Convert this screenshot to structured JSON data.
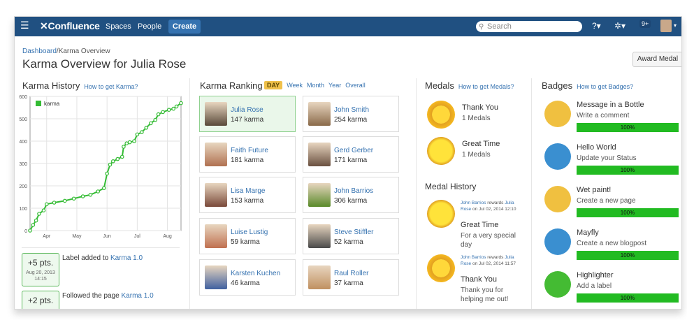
{
  "topbar": {
    "logo": "Confluence",
    "spaces": "Spaces",
    "people": "People",
    "create": "Create",
    "search_placeholder": "Search",
    "notif_count": "9+"
  },
  "breadcrumb": {
    "root": "Dashboard",
    "current": "/Karma Overview"
  },
  "page_title": "Karma Overview for Julia Rose",
  "award_button": "Award Medal",
  "karma_history": {
    "heading": "Karma History",
    "help": "How to get Karma?",
    "chart_data": {
      "type": "line",
      "title": "",
      "series": [
        {
          "name": "karma",
          "values": [
            {
              "x": 0.0,
              "y": 0
            },
            {
              "x": 0.02,
              "y": 25
            },
            {
              "x": 0.04,
              "y": 45
            },
            {
              "x": 0.06,
              "y": 75
            },
            {
              "x": 0.09,
              "y": 90
            },
            {
              "x": 0.11,
              "y": 118
            },
            {
              "x": 0.16,
              "y": 125
            },
            {
              "x": 0.23,
              "y": 133
            },
            {
              "x": 0.29,
              "y": 143
            },
            {
              "x": 0.35,
              "y": 153
            },
            {
              "x": 0.4,
              "y": 160
            },
            {
              "x": 0.45,
              "y": 175
            },
            {
              "x": 0.49,
              "y": 190
            },
            {
              "x": 0.51,
              "y": 255
            },
            {
              "x": 0.53,
              "y": 295
            },
            {
              "x": 0.55,
              "y": 310
            },
            {
              "x": 0.58,
              "y": 320
            },
            {
              "x": 0.61,
              "y": 330
            },
            {
              "x": 0.62,
              "y": 375
            },
            {
              "x": 0.64,
              "y": 390
            },
            {
              "x": 0.66,
              "y": 395
            },
            {
              "x": 0.69,
              "y": 400
            },
            {
              "x": 0.71,
              "y": 430
            },
            {
              "x": 0.74,
              "y": 440
            },
            {
              "x": 0.77,
              "y": 460
            },
            {
              "x": 0.8,
              "y": 480
            },
            {
              "x": 0.83,
              "y": 495
            },
            {
              "x": 0.85,
              "y": 520
            },
            {
              "x": 0.88,
              "y": 530
            },
            {
              "x": 0.92,
              "y": 540
            },
            {
              "x": 0.95,
              "y": 545
            },
            {
              "x": 0.97,
              "y": 555
            },
            {
              "x": 1.0,
              "y": 570
            }
          ]
        }
      ],
      "x_ticks": [
        "Apr",
        "May",
        "Jun",
        "Jul",
        "Aug"
      ],
      "y_ticks": [
        0,
        100,
        200,
        300,
        400,
        500,
        600
      ],
      "ylim": [
        0,
        600
      ],
      "xlim": [
        0,
        1
      ],
      "grid": true,
      "legend": "top-left",
      "colors": {
        "line": "#33bb33"
      }
    }
  },
  "activities": [
    {
      "pts": "+5 pts.",
      "date": "Aug 20, 2013 14:15",
      "text": "Label added to",
      "link": "Karma 1.0"
    },
    {
      "pts": "+2 pts.",
      "date": "",
      "text": "Followed the page",
      "link": "Karma 1.0"
    }
  ],
  "ranking": {
    "heading": "Karma Ranking",
    "tabs": [
      "DAY",
      "Week",
      "Month",
      "Year",
      "Overall"
    ],
    "people": [
      {
        "name": "Julia Rose",
        "karma": "147 karma",
        "color": "#5a4a3a"
      },
      {
        "name": "John Smith",
        "karma": "254 karma",
        "color": "#8a6a4a"
      },
      {
        "name": "Faith Future",
        "karma": "181 karma",
        "color": "#b07050"
      },
      {
        "name": "Gerd Gerber",
        "karma": "171 karma",
        "color": "#6a5040"
      },
      {
        "name": "Lisa Marge",
        "karma": "153 karma",
        "color": "#7a4a3a"
      },
      {
        "name": "John Barrios",
        "karma": "306 karma",
        "color": "#5a8a2a"
      },
      {
        "name": "Luise Lustig",
        "karma": "59 karma",
        "color": "#c07050"
      },
      {
        "name": "Steve Stiffler",
        "karma": "52 karma",
        "color": "#4a4a4a"
      },
      {
        "name": "Karsten Kuchen",
        "karma": "46 karma",
        "color": "#4060a0"
      },
      {
        "name": "Raul Roller",
        "karma": "37 karma",
        "color": "#c09060"
      }
    ]
  },
  "medals": {
    "heading": "Medals",
    "help": "How to get Medals?",
    "items": [
      {
        "title": "Thank You",
        "count": "1 Medals"
      },
      {
        "title": "Great Time",
        "count": "1 Medals"
      }
    ],
    "history_heading": "Medal History",
    "history": [
      {
        "who": "John Barrios",
        "middle": " rewards ",
        "target": "Julia Rose",
        "when": " on Jul 02, 2014 12:10",
        "title": "Great Time",
        "desc": "For a very special day"
      },
      {
        "who": "John Barrios",
        "middle": " rewards ",
        "target": "Julia Rose",
        "when": " on Jul 02, 2014 11:57",
        "title": "Thank You",
        "desc": "Thank you for helping me out!"
      }
    ]
  },
  "badges": {
    "heading": "Badges",
    "help": "How to get Badges?",
    "items": [
      {
        "title": "Message in a Bottle",
        "desc": "Write a comment",
        "progress": "100%",
        "color": "#f0c040"
      },
      {
        "title": "Hello World",
        "desc": "Update your Status",
        "progress": "100%",
        "color": "#3a8fd0"
      },
      {
        "title": "Wet paint!",
        "desc": "Create a new page",
        "progress": "100%",
        "color": "#f0c040"
      },
      {
        "title": "Mayfly",
        "desc": "Create a new blogpost",
        "progress": "100%",
        "color": "#3a8fd0"
      },
      {
        "title": "Highlighter",
        "desc": "Add a label",
        "progress": "100%",
        "color": "#44bb33"
      }
    ]
  }
}
